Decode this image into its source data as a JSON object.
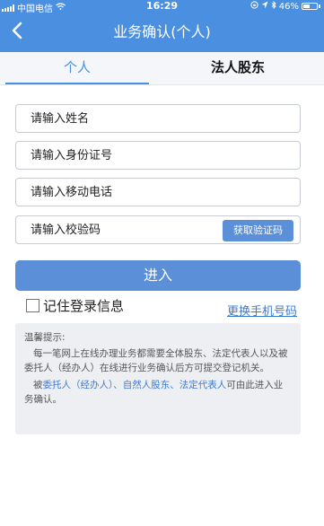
{
  "status_bar": {
    "carrier": "中国电信",
    "time": "16:29",
    "battery": "46%"
  },
  "nav": {
    "title": "业务确认(个人)",
    "back_icon": "chevron-left-icon"
  },
  "tabs": [
    {
      "label": "个人",
      "active": true
    },
    {
      "label": "法人股东",
      "active": false
    }
  ],
  "form": {
    "name_placeholder": "请输入姓名",
    "id_placeholder": "请输入身份证号",
    "phone_placeholder": "请输入移动电话",
    "code_placeholder": "请输入校验码",
    "get_code_label": "获取验证码",
    "enter_label": "进入",
    "remember_label": "记住登录信息",
    "remember_checked": false,
    "change_phone_label": "更换手机号码"
  },
  "tips": {
    "title": "温馨提示:",
    "para1": "每一笔网上在线办理业务都需要全体股东、法定代表人以及被委托人（经办人）在线进行业务确认后方可提交登记机关。",
    "para2_prefix": "被",
    "highlight1": "委托人（经办人）",
    "sep1": "、",
    "highlight2": "自然人股东",
    "sep2": "、",
    "highlight3": "法定代表人",
    "para2_suffix": "可由此进入业务确认。"
  },
  "colors": {
    "primary": "#4a8fe0",
    "button": "#5b8fd8",
    "link": "#3d7bd1"
  }
}
